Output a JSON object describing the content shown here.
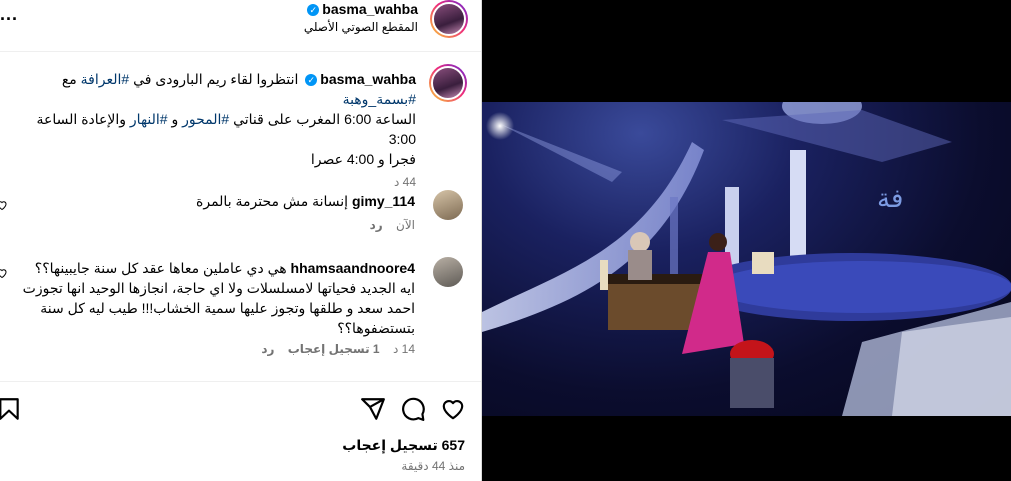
{
  "header": {
    "username": "basma_wahba",
    "audio_label": "المقطع الصوتي الأصلي",
    "more_label": "..."
  },
  "caption": {
    "username": "basma_wahba",
    "line1": "انتظروا لقاء ريم البارودى في",
    "tag_arafa": "#العرافة",
    "with": "مع",
    "tag_basma": "#بسمة_وهبة",
    "line2a": "الساعة 6:00 المغرب على قناتي",
    "tag_mehwar": "#المحور",
    "and": "و",
    "tag_nahar": "#النهار",
    "line2b": "والإعادة الساعة 3:00",
    "line3": "فجرا و 4:00 عصرا",
    "time": "44 د"
  },
  "comments": [
    {
      "username": "gimy_114",
      "text": "إنسانة مش محترمة بالمرة",
      "time": "الآن",
      "reply": "رد"
    },
    {
      "username": "hhamsaandnoore4",
      "text_l1": "هي دي عاملين معاها عقد كل سنة جايبينها؟؟",
      "text_l2": "ايه الجديد فحياتها لامسلسلات ولا اي حاجة، انجازها الوحيد انها تجوزت",
      "text_l3": "احمد سعد و طلقها وتجوز عليها سمية الخشاب!!! طيب ليه كل سنة",
      "text_l4": "بتستضفوها؟؟",
      "time": "14 د",
      "likes": "1 تسجيل إعجاب",
      "reply": "رد"
    }
  ],
  "actions": {
    "likes": "657 تسجيل إعجاب",
    "posted": "منذ 44 دقيقة"
  },
  "icons": [
    "verified-icon",
    "more-icon",
    "heart-icon",
    "comment-icon",
    "share-icon",
    "bookmark-icon",
    "mute-icon"
  ],
  "colors": {
    "link": "#00376b",
    "verified": "#0095f6",
    "muted": "#737373"
  }
}
